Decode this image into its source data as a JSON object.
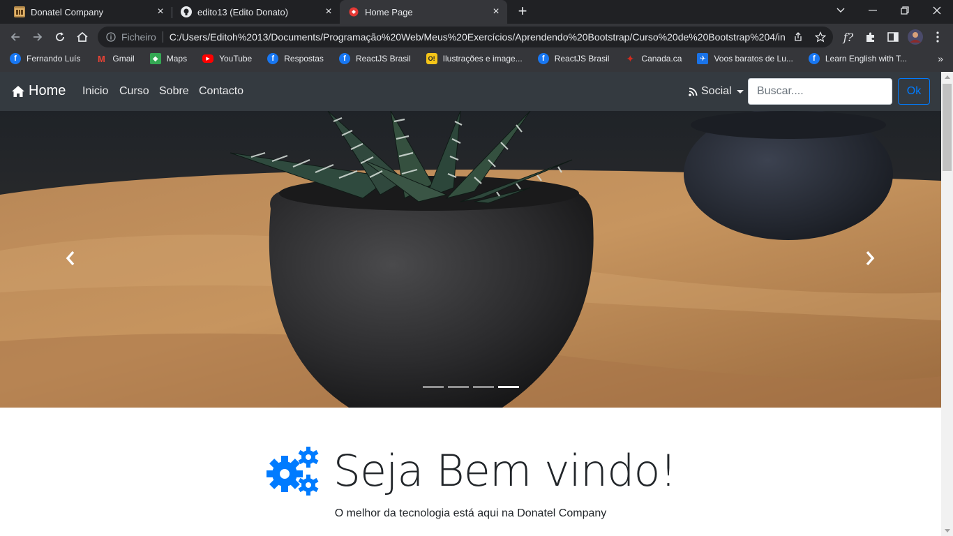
{
  "browser": {
    "tabs": [
      {
        "title": "Donatel Company",
        "active": false,
        "icon": "folder-tab-icon"
      },
      {
        "title": "edito13 (Edito Donato)",
        "active": false,
        "icon": "github-icon"
      },
      {
        "title": "Home Page",
        "active": true,
        "icon": "page-favicon-icon"
      }
    ],
    "omnibox": {
      "scheme_label": "Ficheiro",
      "url": "C:/Users/Editoh%2013/Documents/Programação%20Web/Meus%20Exercícios/Aprendendo%20Bootstrap/Curso%20de%20Bootstrap%204/in..."
    },
    "bookmarks": [
      {
        "label": "Fernando Luís",
        "icon": "facebook-icon",
        "color": "#1877f2"
      },
      {
        "label": "Gmail",
        "icon": "gmail-icon",
        "color": "#ea4335"
      },
      {
        "label": "Maps",
        "icon": "maps-icon",
        "color": "#34a853"
      },
      {
        "label": "YouTube",
        "icon": "youtube-icon",
        "color": "#ff0000"
      },
      {
        "label": "Respostas",
        "icon": "facebook-icon",
        "color": "#1877f2"
      },
      {
        "label": "ReactJS Brasil",
        "icon": "facebook-icon",
        "color": "#1877f2"
      },
      {
        "label": "Ilustrações e image...",
        "icon": "illustrations-icon",
        "color": "#f5c518"
      },
      {
        "label": "ReactJS Brasil",
        "icon": "facebook-icon",
        "color": "#1877f2"
      },
      {
        "label": "Canada.ca",
        "icon": "maple-leaf-icon",
        "color": "#d52b1e"
      },
      {
        "label": "Voos baratos de Lu...",
        "icon": "flights-icon",
        "color": "#1a73e8"
      },
      {
        "label": "Learn English with T...",
        "icon": "facebook-icon",
        "color": "#1877f2"
      }
    ]
  },
  "page": {
    "navbar": {
      "brand": "Home",
      "links": [
        "Inicio",
        "Curso",
        "Sobre",
        "Contacto"
      ],
      "social_label": "Social",
      "search_placeholder": "Buscar....",
      "ok_label": "Ok"
    },
    "carousel": {
      "slide_count": 4,
      "active_index": 3
    },
    "welcome": {
      "title": "Seja Bem vindo!",
      "subtitle": "O melhor da tecnologia está aqui na Donatel Company"
    },
    "colors": {
      "navbar_bg": "#343a40",
      "primary": "#007bff",
      "text": "#212529"
    }
  }
}
